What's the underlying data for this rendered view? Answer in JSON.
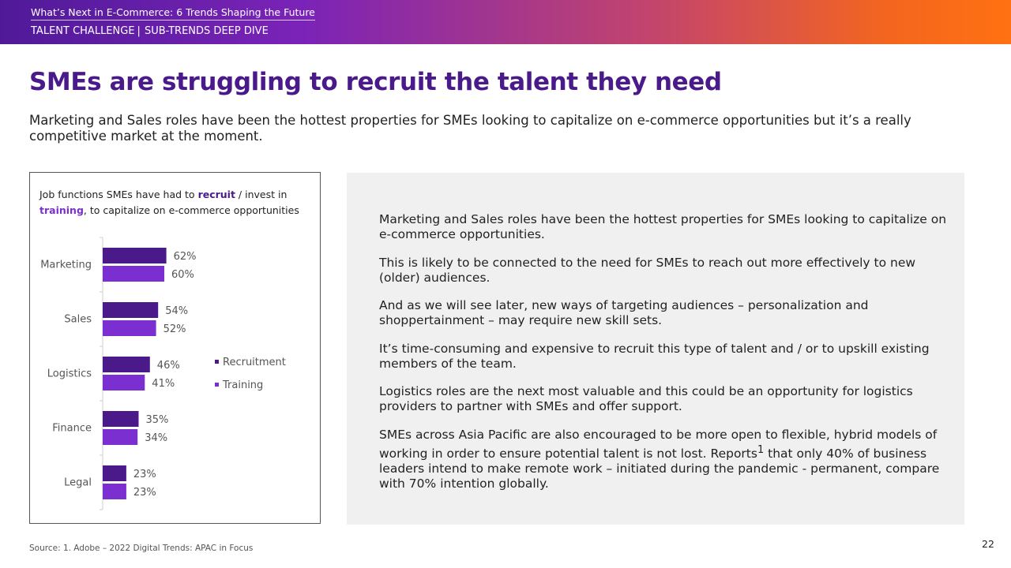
{
  "header": {
    "deck_title": "What’s Next in E-Commerce: 6 Trends Shaping the Future",
    "section_left": "TALENT CHALLENGE",
    "separator": "|",
    "section_right": "SUB-TRENDS DEEP DIVE"
  },
  "headline": "SMEs are struggling to recruit the talent they need",
  "subtitle": "Marketing and Sales roles have been the hottest properties for SMEs looking to capitalize on e-commerce opportunities but it’s a really competitive market at the moment.",
  "chart_caption": {
    "part1": "Job functions SMEs have had to ",
    "recruit": "recruit",
    "part2": " / invest in ",
    "training": "training",
    "part3": ", to capitalize on e-commerce opportunities"
  },
  "chart_data": {
    "type": "bar",
    "orientation": "horizontal",
    "categories": [
      "Marketing",
      "Sales",
      "Logistics",
      "Finance",
      "Legal"
    ],
    "series": [
      {
        "name": "Recruitment",
        "values": [
          62,
          54,
          46,
          35,
          23
        ],
        "labels": [
          "62%",
          "54%",
          "46%",
          "35%",
          "23%"
        ]
      },
      {
        "name": "Training",
        "values": [
          60,
          52,
          41,
          34,
          23
        ],
        "labels": [
          "60%",
          "52%",
          "41%",
          "34%",
          "23%"
        ]
      }
    ],
    "unit": "%",
    "legend_position": "right",
    "colors": {
      "Recruitment": "#4b1a8a",
      "Training": "#7b2fd1"
    }
  },
  "panel_paragraphs": [
    "Marketing and Sales roles have been the hottest properties for SMEs looking to capitalize on e-commerce opportunities.",
    "This is likely to be connected to the need for SMEs to reach out more effectively to new (older) audiences.",
    "And as we will see later, new ways of targeting audiences – personalization and shoppertainment – may require new skill sets.",
    "It’s time-consuming and expensive to recruit this type of talent and / or to upskill existing members of the team.",
    "Logistics roles are the next most valuable and this could be an opportunity for logistics providers to partner with SMEs and offer support."
  ],
  "panel_last": {
    "before": "SMEs across Asia Pacific are also encouraged to be more open to flexible, hybrid models of working in order to ensure potential talent is not lost. Reports",
    "sup": "1",
    "after": " that only 40% of business leaders intend to make remote work – initiated during the pandemic - permanent, compare with 70% intention globally."
  },
  "source": "Source: 1. Adobe – 2022 Digital Trends: APAC in Focus",
  "page_number": "22",
  "colors": {
    "accent": "#4b1a8a",
    "training": "#7b2fd1",
    "banner_end": "#ff7111"
  }
}
